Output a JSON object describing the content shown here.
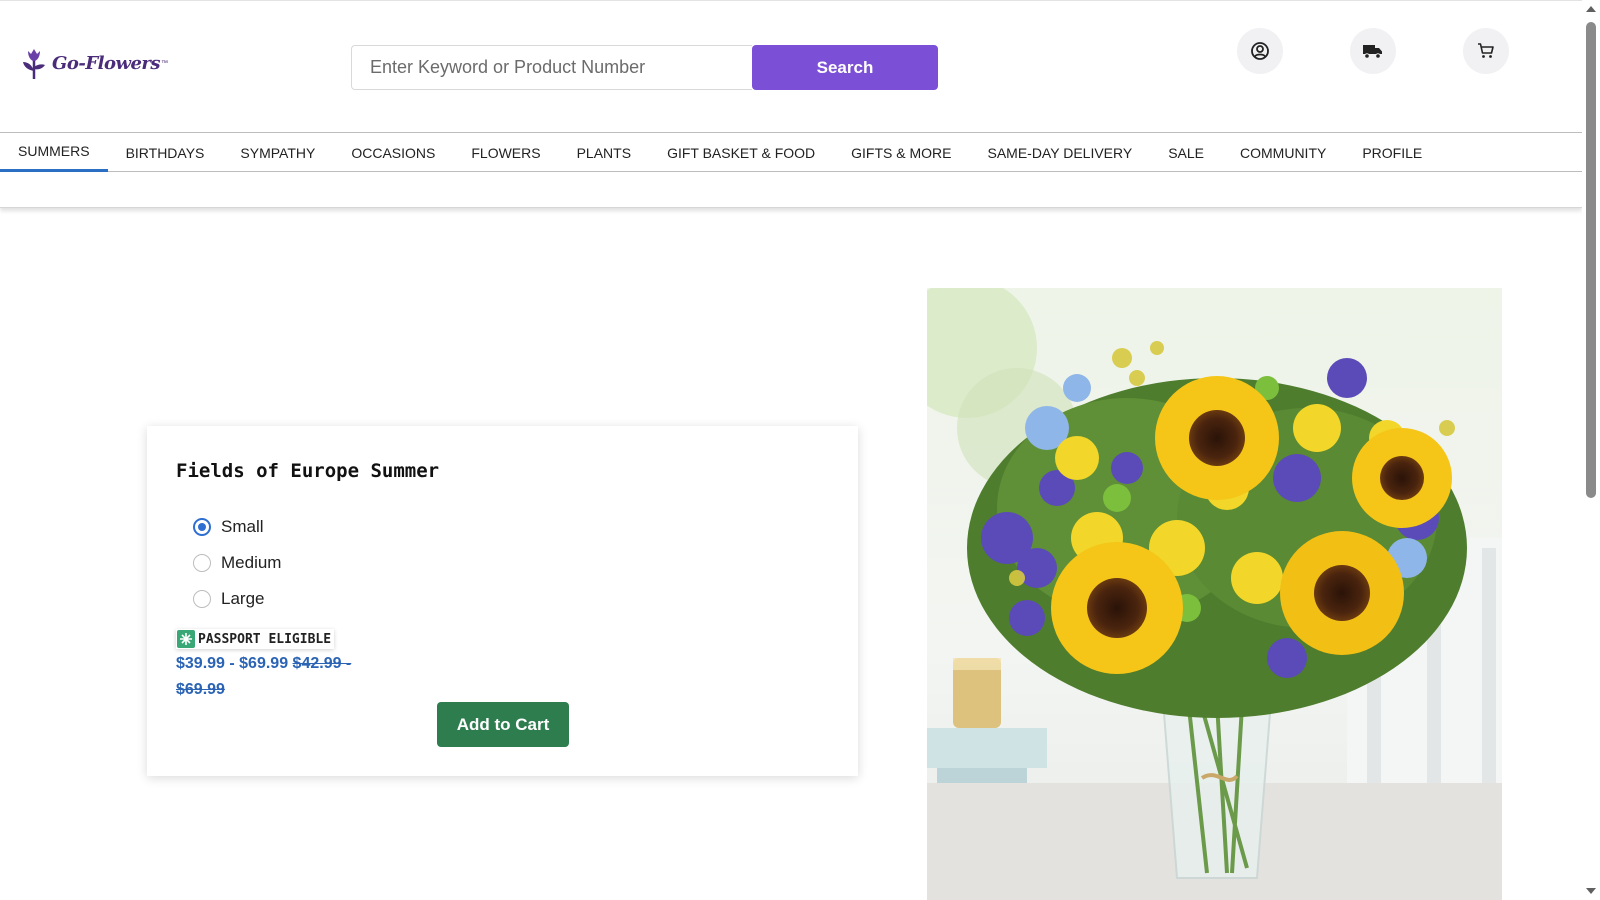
{
  "header": {
    "logo_text": "Go-Flowers",
    "logo_mark": "™",
    "search_placeholder": "Enter Keyword or Product Number",
    "search_button": "Search",
    "icons": [
      "account-icon",
      "delivery-truck-icon",
      "cart-icon"
    ]
  },
  "nav": {
    "items": [
      "SUMMERS",
      "BIRTHDAYS",
      "SYMPATHY",
      "OCCASIONS",
      "FLOWERS",
      "PLANTS",
      "GIFT BASKET & FOOD",
      "GIFTS & MORE",
      "SAME-DAY DELIVERY",
      "SALE",
      "COMMUNITY",
      "PROFILE"
    ],
    "active": "SUMMERS"
  },
  "product": {
    "title": "Fields of Europe Summer",
    "sizes": [
      "Small",
      "Medium",
      "Large"
    ],
    "selected_size": "Small",
    "badge": "PASSPORT ELIGIBLE",
    "price_range": "$39.99 - $69.99",
    "original_price": "$42.99 - $69.99",
    "add_to_cart": "Add to Cart"
  },
  "colors": {
    "brand": "#4a2c7a",
    "search_button": "#7b4fd6",
    "active_tab": "#2b6fc4",
    "price": "#2b63b5",
    "add_to_cart": "#2e7d4f",
    "passport_badge": "#3aa876"
  }
}
